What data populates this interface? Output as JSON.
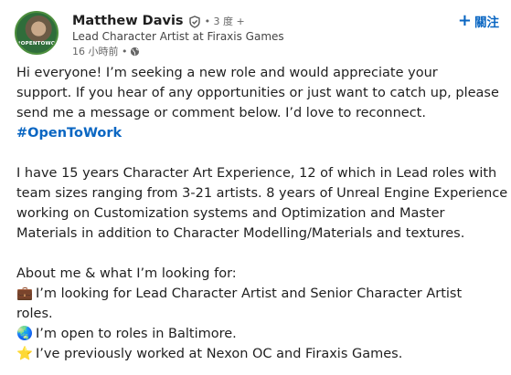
{
  "author": {
    "name": "Matthew Davis",
    "degree": "• 3 度 +",
    "headline": "Lead Character Artist at Firaxis Games",
    "posted": "16 小時前 •",
    "avatar_text": "#OPENTOWORK",
    "verified_icon": "verified-shield-icon",
    "visibility_icon": "globe-icon"
  },
  "follow": {
    "label": "關注",
    "icon": "plus-icon"
  },
  "post": {
    "p1": [
      "Hi everyone! I’m seeking a new role and would appreciate your",
      "support. If you hear of any opportunities or just want to catch up, please",
      "send me a message or comment below. I’d love to reconnect."
    ],
    "hashtag": "#OpenToWork",
    "p2": [
      "I have 15 years Character Art Experience, 12 of which in Lead roles with",
      "team sizes ranging from 3-21 artists. 8 years of Unreal Engine Experience",
      "working on Customization systems and Optimization and Master",
      "Materials in addition to Character Modelling/Materials and textures."
    ],
    "p3_heading": "About me & what I’m looking for:",
    "bullets": [
      {
        "emoji": "💼",
        "lines": [
          "I’m looking for Lead Character Artist and Senior Character Artist",
          "roles."
        ]
      },
      {
        "emoji": "🌏",
        "lines": [
          "I’m open to roles in Baltimore."
        ]
      },
      {
        "emoji": "⭐",
        "lines": [
          "I’ve previously worked at Nexon OC and Firaxis Games."
        ]
      }
    ]
  },
  "colors": {
    "link": "#0a66c2",
    "text": "#1f1f1f",
    "muted": "#666666"
  }
}
